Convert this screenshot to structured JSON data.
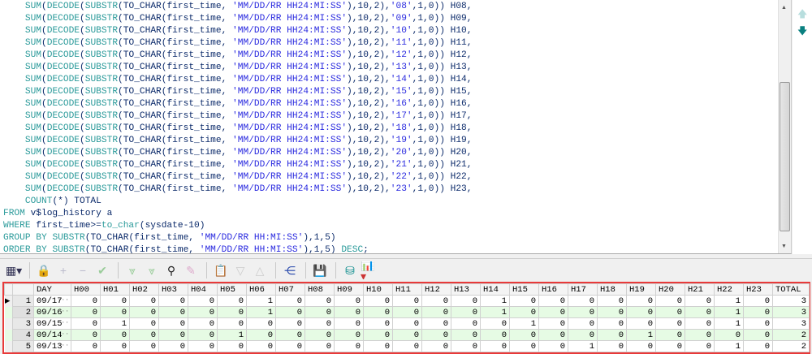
{
  "editor": {
    "lines": [
      "    SUM(DECODE(SUBSTR(TO_CHAR(first_time, 'MM/DD/RR HH24:MI:SS'),10,2),'08',1,0)) H08,",
      "    SUM(DECODE(SUBSTR(TO_CHAR(first_time, 'MM/DD/RR HH24:MI:SS'),10,2),'09',1,0)) H09,",
      "    SUM(DECODE(SUBSTR(TO_CHAR(first_time, 'MM/DD/RR HH24:MI:SS'),10,2),'10',1,0)) H10,",
      "    SUM(DECODE(SUBSTR(TO_CHAR(first_time, 'MM/DD/RR HH24:MI:SS'),10,2),'11',1,0)) H11,",
      "    SUM(DECODE(SUBSTR(TO_CHAR(first_time, 'MM/DD/RR HH24:MI:SS'),10,2),'12',1,0)) H12,",
      "    SUM(DECODE(SUBSTR(TO_CHAR(first_time, 'MM/DD/RR HH24:MI:SS'),10,2),'13',1,0)) H13,",
      "    SUM(DECODE(SUBSTR(TO_CHAR(first_time, 'MM/DD/RR HH24:MI:SS'),10,2),'14',1,0)) H14,",
      "    SUM(DECODE(SUBSTR(TO_CHAR(first_time, 'MM/DD/RR HH24:MI:SS'),10,2),'15',1,0)) H15,",
      "    SUM(DECODE(SUBSTR(TO_CHAR(first_time, 'MM/DD/RR HH24:MI:SS'),10,2),'16',1,0)) H16,",
      "    SUM(DECODE(SUBSTR(TO_CHAR(first_time, 'MM/DD/RR HH24:MI:SS'),10,2),'17',1,0)) H17,",
      "    SUM(DECODE(SUBSTR(TO_CHAR(first_time, 'MM/DD/RR HH24:MI:SS'),10,2),'18',1,0)) H18,",
      "    SUM(DECODE(SUBSTR(TO_CHAR(first_time, 'MM/DD/RR HH24:MI:SS'),10,2),'19',1,0)) H19,",
      "    SUM(DECODE(SUBSTR(TO_CHAR(first_time, 'MM/DD/RR HH24:MI:SS'),10,2),'20',1,0)) H20,",
      "    SUM(DECODE(SUBSTR(TO_CHAR(first_time, 'MM/DD/RR HH24:MI:SS'),10,2),'21',1,0)) H21,",
      "    SUM(DECODE(SUBSTR(TO_CHAR(first_time, 'MM/DD/RR HH24:MI:SS'),10,2),'22',1,0)) H22,",
      "    SUM(DECODE(SUBSTR(TO_CHAR(first_time, 'MM/DD/RR HH24:MI:SS'),10,2),'23',1,0)) H23,",
      "    COUNT(*) TOTAL",
      "FROM v$log_history a",
      "WHERE first_time>=to_char(sysdate-10)",
      "GROUP BY SUBSTR(TO_CHAR(first_time, 'MM/DD/RR HH:MI:SS'),1,5)",
      "ORDER BY SUBSTR(TO_CHAR(first_time, 'MM/DD/RR HH:MI:SS'),1,5) DESC;"
    ]
  },
  "toolbar": {
    "icons": [
      "grid-icon",
      "lock-icon",
      "add-icon",
      "remove-icon",
      "check-icon",
      "fetch-next-icon",
      "fetch-all-icon",
      "find-icon",
      "clear-icon",
      "query-by-example-icon",
      "filter-down-icon",
      "filter-up-icon",
      "tree-icon",
      "save-icon",
      "export-icon",
      "chart-icon"
    ]
  },
  "grid": {
    "columns": [
      "DAY",
      "H00",
      "H01",
      "H02",
      "H03",
      "H04",
      "H05",
      "H06",
      "H07",
      "H08",
      "H09",
      "H10",
      "H11",
      "H12",
      "H13",
      "H14",
      "H15",
      "H16",
      "H17",
      "H18",
      "H19",
      "H20",
      "H21",
      "H22",
      "H23",
      "TOTAL"
    ],
    "rows": [
      [
        "09/17",
        "0",
        "0",
        "0",
        "0",
        "0",
        "0",
        "1",
        "0",
        "0",
        "0",
        "0",
        "0",
        "0",
        "0",
        "1",
        "0",
        "0",
        "0",
        "0",
        "0",
        "0",
        "0",
        "1",
        "0",
        "3"
      ],
      [
        "09/16",
        "0",
        "0",
        "0",
        "0",
        "0",
        "0",
        "1",
        "0",
        "0",
        "0",
        "0",
        "0",
        "0",
        "0",
        "1",
        "0",
        "0",
        "0",
        "0",
        "0",
        "0",
        "0",
        "1",
        "0",
        "3"
      ],
      [
        "09/15",
        "0",
        "1",
        "0",
        "0",
        "0",
        "0",
        "0",
        "0",
        "0",
        "0",
        "0",
        "0",
        "0",
        "0",
        "0",
        "1",
        "0",
        "0",
        "0",
        "0",
        "0",
        "0",
        "1",
        "0",
        "3"
      ],
      [
        "09/14",
        "0",
        "0",
        "0",
        "0",
        "0",
        "1",
        "0",
        "0",
        "0",
        "0",
        "0",
        "0",
        "0",
        "0",
        "0",
        "0",
        "0",
        "0",
        "0",
        "1",
        "0",
        "0",
        "0",
        "0",
        "2"
      ],
      [
        "09/13",
        "0",
        "0",
        "0",
        "0",
        "0",
        "0",
        "0",
        "0",
        "0",
        "0",
        "0",
        "0",
        "0",
        "0",
        "0",
        "0",
        "0",
        "1",
        "0",
        "0",
        "0",
        "0",
        "1",
        "0",
        "2"
      ]
    ]
  }
}
